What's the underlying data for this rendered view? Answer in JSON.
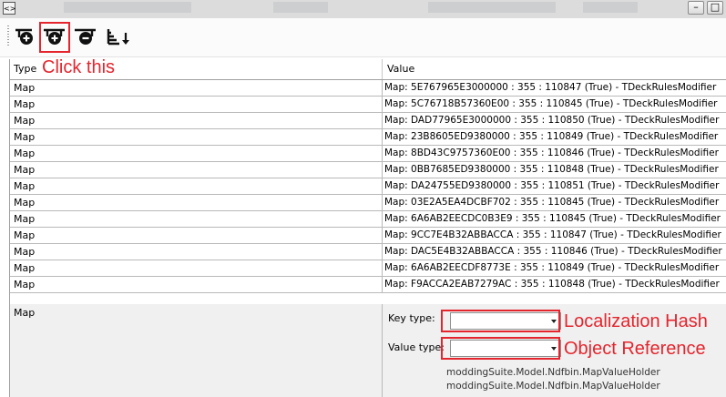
{
  "titlebar": {
    "app_icon": "window-icon",
    "minimize_icon": "minimize-icon",
    "maximize_icon": "maximize-icon"
  },
  "toolbar": {
    "icons": [
      "add-item-icon",
      "add-item-icon",
      "remove-item-icon",
      "sort-descending-icon"
    ]
  },
  "annotations": {
    "click": "Click this",
    "key_type": "Localization Hash",
    "value_type": "Object Reference",
    "color": "#e4252d"
  },
  "grid": {
    "columns": [
      "Type",
      "Value"
    ],
    "rows": [
      {
        "type": "Map",
        "value": "Map: 5E767965E3000000 : 355 : 110847 (True) - TDeckRulesModifier"
      },
      {
        "type": "Map",
        "value": "Map: 5C76718B57360E00 : 355 : 110845 (True) - TDeckRulesModifier"
      },
      {
        "type": "Map",
        "value": "Map: DAD77965E3000000 : 355 : 110850 (True) - TDeckRulesModifier"
      },
      {
        "type": "Map",
        "value": "Map: 23B8605ED9380000 : 355 : 110849 (True) - TDeckRulesModifier"
      },
      {
        "type": "Map",
        "value": "Map: 8BD43C9757360E00 : 355 : 110846 (True) - TDeckRulesModifier"
      },
      {
        "type": "Map",
        "value": "Map: 0BB7685ED9380000 : 355 : 110848 (True) - TDeckRulesModifier"
      },
      {
        "type": "Map",
        "value": "Map: DA24755ED9380000 : 355 : 110851 (True) - TDeckRulesModifier"
      },
      {
        "type": "Map",
        "value": "Map: 03E2A5EA4DCBF702 : 355 : 110845 (True) - TDeckRulesModifier"
      },
      {
        "type": "Map",
        "value": "Map: 6A6AB2EECDC0B3E9 : 355 : 110845 (True) - TDeckRulesModifier"
      },
      {
        "type": "Map",
        "value": "Map: 9CC7E4B32ABBACCA : 355 : 110847 (True) - TDeckRulesModifier"
      },
      {
        "type": "Map",
        "value": "Map: DAC5E4B32ABBACCA : 355 : 110846 (True) - TDeckRulesModifier"
      },
      {
        "type": "Map",
        "value": "Map: 6A6AB2EECDF8773E : 355 : 110849 (True) - TDeckRulesModifier"
      },
      {
        "type": "Map",
        "value": "Map: F9ACCA2EAB7279AC : 355 : 110848 (True) - TDeckRulesModifier"
      }
    ],
    "edit_row": {
      "type": "Map",
      "key_type_label": "Key type:",
      "key_type_value": "",
      "value_type_label": "Value type:",
      "value_type_value": "",
      "holders": [
        "moddingSuite.Model.Ndfbin.MapValueHolder",
        "moddingSuite.Model.Ndfbin.MapValueHolder"
      ]
    }
  }
}
